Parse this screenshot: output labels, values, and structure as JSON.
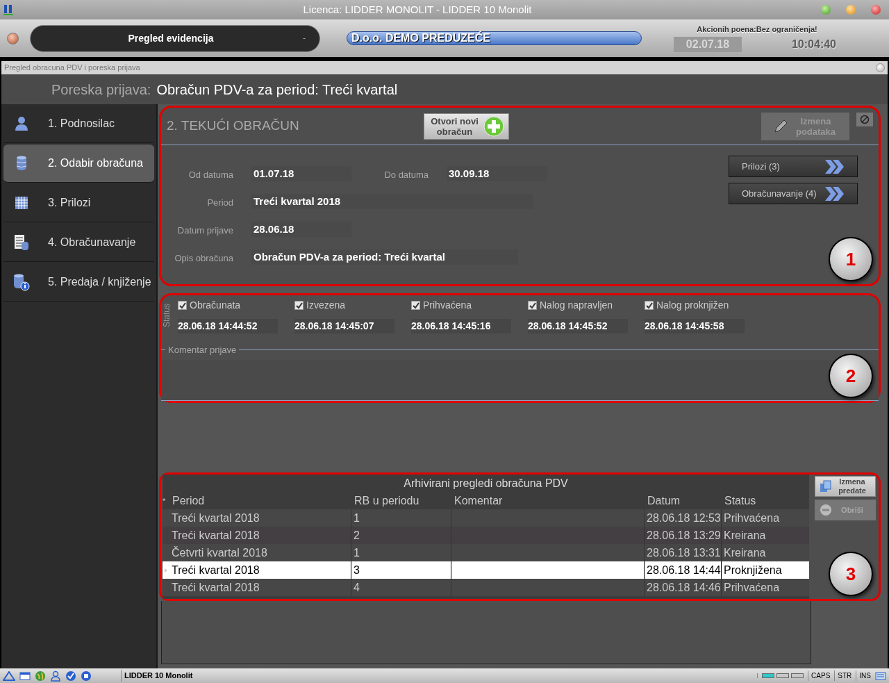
{
  "window": {
    "title": "Licenca: LIDDER MONOLIT - LIDDER 10 Monolit"
  },
  "toolbar": {
    "module": "Pregled evidencija",
    "module_dash": "-",
    "company": "D.o.o. DEMO PREDUZEĆE",
    "promo": "Akcionih poena:Bez ograničenja!",
    "date": "02.07.18",
    "time": "10:04:40"
  },
  "subwindow": {
    "title": "Pregled obracuna PDV i poreska prijava"
  },
  "header": {
    "prefix": "Poreska prijava:",
    "title": "Obračun PDV-a za period: Treći kvartal"
  },
  "sidebar": {
    "items": [
      {
        "label": "1. Podnosilac",
        "kind": "person",
        "selected": false
      },
      {
        "label": "2. Odabir obračuna",
        "kind": "database",
        "selected": true
      },
      {
        "label": "3. Prilozi",
        "kind": "grid",
        "selected": false
      },
      {
        "label": "4. Obračunavanje",
        "kind": "sheet",
        "selected": false
      },
      {
        "label": "5. Predaja / knjiženje",
        "kind": "info",
        "selected": false
      }
    ]
  },
  "current": {
    "title": "2. TEKUĆI OBRAČUN",
    "new_button": "Otvori novi obračun",
    "edit_button": {
      "label": "Izmena podataka",
      "disabled": true
    },
    "fields": [
      {
        "label": "Od datuma",
        "value": "01.07.18"
      },
      {
        "label": "Do datuma",
        "value": "30.09.18"
      },
      {
        "label": "Period",
        "value": "Treći kvartal 2018"
      },
      {
        "label": "Datum prijave",
        "value": "28.06.18"
      },
      {
        "label": "Opis obračuna",
        "value": "Obračun PDV-a za period: Treći kvartal"
      }
    ],
    "nav_buttons": [
      "Prilozi (3)",
      "Obračunavanje (4)"
    ],
    "marker": "1"
  },
  "status": {
    "label": "Status",
    "items": [
      {
        "label": "Obračunata",
        "checked": true,
        "time": "28.06.18 14:44:52"
      },
      {
        "label": "Izvezena",
        "checked": true,
        "time": "28.06.18 14:45:07"
      },
      {
        "label": "Prihvaćena",
        "checked": true,
        "time": "28.06.18 14:45:16"
      },
      {
        "label": "Nalog napravljen",
        "checked": true,
        "time": "28.06.18 14:45:52"
      },
      {
        "label": "Nalog proknjižen",
        "checked": true,
        "time": "28.06.18 14:45:58"
      }
    ],
    "comment_label": "Komentar prijave",
    "marker": "2"
  },
  "archive": {
    "title": "Arhivirani pregledi obračuna PDV",
    "new_row_marker": "*",
    "columns": [
      "Period",
      "RB u periodu",
      "Komentar",
      "Datum",
      "Status"
    ],
    "rows": [
      {
        "cells": [
          "Treći kvartal 2018",
          "1",
          "",
          "28.06.18 12:53",
          "Prihvaćena"
        ],
        "selected": false
      },
      {
        "cells": [
          "Treći kvartal 2018",
          "2",
          "",
          "28.06.18 13:29",
          "Kreirana"
        ],
        "selected": false
      },
      {
        "cells": [
          "Četvrti kvartal 2018",
          "1",
          "",
          "28.06.18 13:31",
          "Kreirana"
        ],
        "selected": false
      },
      {
        "cells": [
          "Treći kvartal 2018",
          "3",
          "",
          "28.06.18 14:44",
          "Proknjižena"
        ],
        "selected": true
      },
      {
        "cells": [
          "Treći kvartal 2018",
          "4",
          "",
          "28.06.18 14:46",
          "Prihvaćena"
        ],
        "selected": false
      }
    ],
    "buttons": [
      {
        "label": "Izmena predate",
        "disabled": false
      },
      {
        "label": "Obriši",
        "disabled": true
      }
    ],
    "marker": "3"
  },
  "status_bar": {
    "app": "LIDDER 10 Monolit",
    "indicators": [
      {
        "on": true
      },
      {
        "on": false
      },
      {
        "on": false
      }
    ],
    "keys": [
      "CAPS",
      "STR",
      "INS"
    ]
  }
}
